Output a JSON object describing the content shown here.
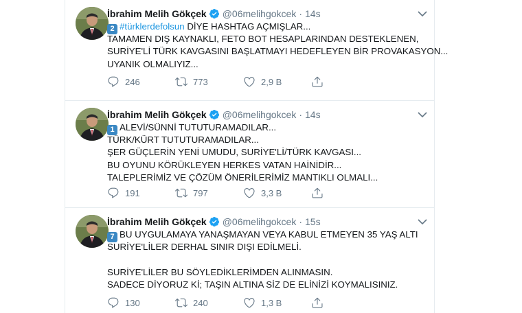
{
  "tweets": [
    {
      "name": "İbrahim Melih Gökçek",
      "handle": "@06melihgokcek",
      "time": "14s",
      "keycap": "2",
      "lines": [
        "#türklerdefolsun DİYE HASHTAG AÇMIŞLAR...",
        "TAMAMEN DIŞ KAYNAKLI, FETO BOT HESAPLARINDAN DESTEKLENEN,",
        "SURİYE'Lİ TÜRK KAVGASINI BAŞLATMAYI HEDEFLEYEN BİR PROVAKASYON...",
        "UYANIK OLMALIYIZ..."
      ],
      "first_line_hashtag": "#türklerdefolsun",
      "first_line_rest": " DİYE HASHTAG AÇMIŞLAR...",
      "replies": "246",
      "retweets": "773",
      "likes": "2,9 B"
    },
    {
      "name": "İbrahim Melih Gökçek",
      "handle": "@06melihgokcek",
      "time": "14s",
      "keycap": "1",
      "lines": [
        "ALEVİ/SÜNNİ TUTUTURAMADILAR...",
        "TÜRK/KÜRT TUTUTURAMADILAR...",
        "ŞER GÜÇLERİN YENİ UMUDU,  SURİYE'Lİ/TÜRK KAVGASI...",
        "BU OYUNU KÖRÜKLEYEN HERKES VATAN HAİNİDİR...",
        "TALEPLERİMİZ VE ÇÖZÜM ÖNERİLERİMİZ MANTIKLI OLMALI..."
      ],
      "replies": "191",
      "retweets": "797",
      "likes": "3,3 B"
    },
    {
      "name": "İbrahim Melih Gökçek",
      "handle": "@06melihgokcek",
      "time": "15s",
      "keycap": "7",
      "lines": [
        "BU UYGULAMAYA YANAŞMAYAN VEYA KABUL ETMEYEN 35 YAŞ ALTI",
        "SURİYE'LİLER DERHAL SINIR DIŞI EDİLMELİ.",
        "",
        "SURİYE'LİLER BU SÖYLEDİKLERİMDEN ALINMASIN.",
        "SADECE DİYORUZ Kİ; TAŞIN ALTINA SİZ DE ELİNİZİ KOYMALISINIZ."
      ],
      "replies": "130",
      "retweets": "240",
      "likes": "1,3 B"
    }
  ],
  "dot": "·",
  "icons": {
    "reply": "reply-icon",
    "retweet": "retweet-icon",
    "like": "heart-icon",
    "share": "share-icon",
    "verified": "verified-badge-icon",
    "caret": "chevron-down-icon"
  },
  "colors": {
    "hashtag": "#1b95e0",
    "verified": "#1da1f2",
    "keycap": "#3b88c3",
    "muted": "#657786"
  }
}
